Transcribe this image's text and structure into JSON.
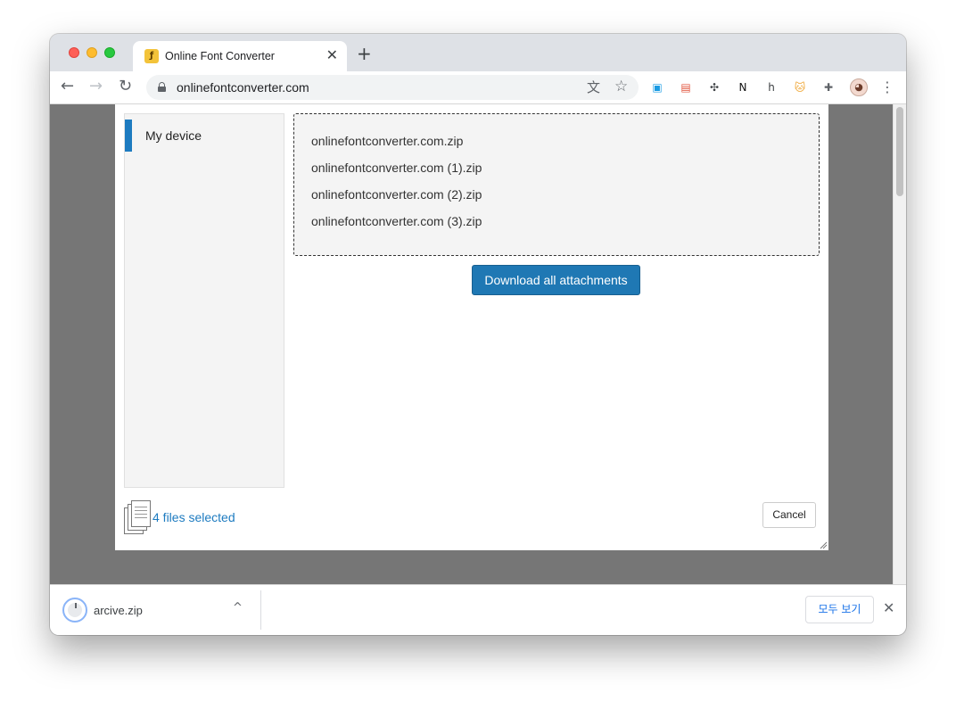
{
  "window": {
    "tab": {
      "title": "Online Font Converter",
      "favicon_glyph": "ƒ",
      "close_glyph": "✕"
    },
    "new_tab_glyph": "+"
  },
  "toolbar": {
    "back_glyph": "←",
    "forward_glyph": "→",
    "reload_glyph": "↻",
    "url": "onlinefontconverter.com",
    "translate_glyph": "文",
    "bookmark_glyph": "☆",
    "extensions": [
      {
        "name": "window-extension-icon",
        "glyph": "▣",
        "color": "#1a9be3"
      },
      {
        "name": "calendar-extension-icon",
        "glyph": "▤",
        "color": "#e0543c"
      },
      {
        "name": "move-extension-icon",
        "glyph": "✣",
        "color": "#3c4043"
      },
      {
        "name": "notion-extension-icon",
        "glyph": "N",
        "color": "#111111"
      },
      {
        "name": "hypothesis-extension-icon",
        "glyph": "h",
        "color": "#3c4043"
      },
      {
        "name": "cat-extension-icon",
        "glyph": "🐱",
        "color": "#f0a93b"
      },
      {
        "name": "puzzle-extension-icon",
        "glyph": "✚",
        "color": "#5f6368"
      }
    ],
    "menu_glyph": "⋮"
  },
  "dialog": {
    "sidebar": {
      "items": [
        {
          "label": "My device"
        }
      ]
    },
    "files": [
      "onlinefontconverter.com.zip",
      "onlinefontconverter.com (1).zip",
      "onlinefontconverter.com (2).zip",
      "onlinefontconverter.com (3).zip"
    ],
    "download_label": "Download all attachments",
    "selected_text": "4 files selected",
    "cancel_label": "Cancel"
  },
  "download_shelf": {
    "file_name": "arcive.zip",
    "chevron_glyph": "^",
    "show_all_label": "모두 보기",
    "close_glyph": "✕"
  },
  "colors": {
    "accent": "#1d7bc0",
    "button": "#1f78b4",
    "overlay": "#767676"
  }
}
